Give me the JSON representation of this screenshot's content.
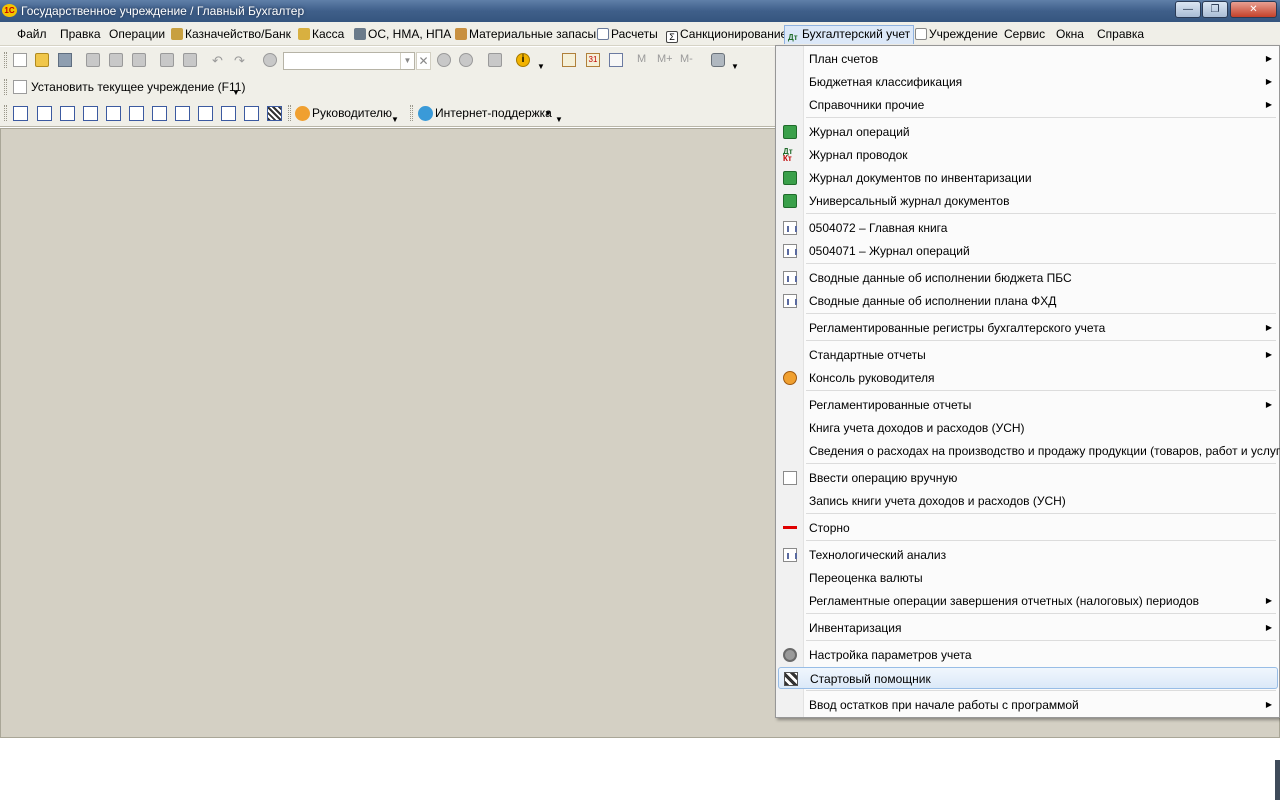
{
  "window": {
    "title": "Государственное учреждение / Главный Бухгалтер",
    "logo_text": "1С",
    "controls": {
      "minimize": "—",
      "maximize": "❐",
      "close": "✕"
    }
  },
  "menubar": {
    "items": [
      {
        "label": "Файл"
      },
      {
        "label": "Правка"
      },
      {
        "label": "Операции"
      },
      {
        "label": "Казначейство/Банк"
      },
      {
        "label": "Касса"
      },
      {
        "label": "ОС, НМА, НПА"
      },
      {
        "label": "Материальные запасы"
      },
      {
        "label": "Расчеты"
      },
      {
        "label": "Санкционирование"
      },
      {
        "label": "Бухгалтерский учет"
      },
      {
        "label": "Учреждение"
      },
      {
        "label": "Сервис"
      },
      {
        "label": "Окна"
      },
      {
        "label": "Справка"
      }
    ],
    "active": "Бухгалтерский учет"
  },
  "toolbar": {
    "search_value": "",
    "text_buttons": {
      "m": "M",
      "m_plus": "M+",
      "m_minus": "M-"
    },
    "set_institution_label": "Установить текущее учреждение (F11)",
    "manager_label": "Руководителю",
    "internet_support_label": "Интернет-поддержка"
  },
  "dropdown": {
    "items": [
      {
        "label": "План счетов",
        "icon": "",
        "submenu": true
      },
      {
        "label": "Бюджетная классификация",
        "icon": "",
        "submenu": true
      },
      {
        "label": "Справочники прочие",
        "icon": "",
        "submenu": true
      },
      {
        "label": "Журнал операций",
        "icon": "journal-icon",
        "submenu": false
      },
      {
        "label": "Журнал проводок",
        "icon": "dt-kt-icon",
        "submenu": false
      },
      {
        "label": "Журнал документов по инвентаризации",
        "icon": "journal-icon",
        "submenu": false
      },
      {
        "label": "Универсальный журнал документов",
        "icon": "journal-icon",
        "submenu": false
      },
      {
        "label": "0504072  –  Главная книга",
        "icon": "report-icon",
        "submenu": false
      },
      {
        "label": "0504071  –  Журнал операций",
        "icon": "report-icon",
        "submenu": false
      },
      {
        "label": "Сводные данные об исполнении бюджета ПБС",
        "icon": "report-icon",
        "submenu": false
      },
      {
        "label": "Сводные данные об исполнении плана ФХД",
        "icon": "report-icon",
        "submenu": false
      },
      {
        "label": "Регламентированные регистры бухгалтерского учета",
        "icon": "",
        "submenu": true
      },
      {
        "label": "Стандартные отчеты",
        "icon": "",
        "submenu": true
      },
      {
        "label": "Консоль руководителя",
        "icon": "console-icon",
        "submenu": false
      },
      {
        "label": "Регламентированные отчеты",
        "icon": "",
        "submenu": true
      },
      {
        "label": "Книга учета доходов и расходов (УСН)",
        "icon": "",
        "submenu": false
      },
      {
        "label": "Сведения о расходах на производство и продажу продукции (товаров, работ и услуг)",
        "icon": "",
        "submenu": false
      },
      {
        "label": "Ввести операцию вручную",
        "icon": "manual-entry-icon",
        "submenu": false
      },
      {
        "label": "Запись книги учета доходов и расходов (УСН)",
        "icon": "",
        "submenu": false
      },
      {
        "label": "Сторно",
        "icon": "storno-icon",
        "submenu": false
      },
      {
        "label": "Технологический анализ",
        "icon": "report-icon",
        "submenu": false
      },
      {
        "label": "Переоценка валюты",
        "icon": "",
        "submenu": false
      },
      {
        "label": "Регламентные операции завершения отчетных (налоговых) периодов",
        "icon": "",
        "submenu": true
      },
      {
        "label": "Инвентаризация",
        "icon": "",
        "submenu": true
      },
      {
        "label": "Настройка параметров учета",
        "icon": "gear-icon",
        "submenu": false
      },
      {
        "label": "Стартовый помощник",
        "icon": "wizard-icon",
        "submenu": false,
        "highlighted": true
      },
      {
        "label": "Ввод остатков при начале работы с программой",
        "icon": "",
        "submenu": true
      }
    ],
    "submenu_arrow": "▶"
  }
}
